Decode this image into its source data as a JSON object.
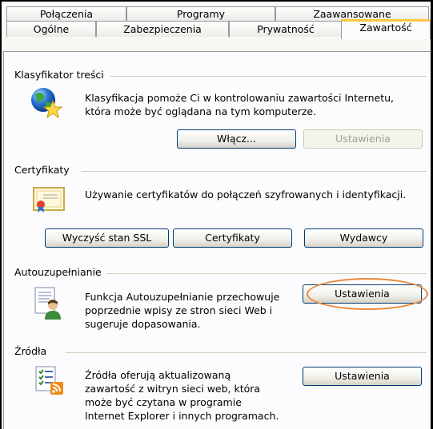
{
  "tabs_row1": [
    "Połączenia",
    "Programy",
    "Zaawansowane"
  ],
  "tabs_row2": [
    "Ogólne",
    "Zabezpieczenia",
    "Prywatność",
    "Zawartość"
  ],
  "content_advisor": {
    "title": "Klasyfikator treści",
    "desc_line1": "Klasyfikacja pomoże Ci w kontrolowaniu zawartości Internetu,",
    "desc_line2": "która może być oglądana na tym komputerze.",
    "enable_button": "Włącz...",
    "settings_button": "Ustawienia"
  },
  "certificates": {
    "title": "Certyfikaty",
    "desc": "Używanie certyfikatów do połączeń szyfrowanych i identyfikacji.",
    "clear_ssl_button": "Wyczyść stan SSL",
    "certificates_button": "Certyfikaty",
    "publishers_button": "Wydawcy"
  },
  "autocomplete": {
    "title": "Autouzupełnianie",
    "desc_line1": "Funkcja Autouzupełnianie przechowuje",
    "desc_line2": "poprzednie wpisy ze stron sieci Web i",
    "desc_line3": "sugeruje dopasowania.",
    "settings_button": "Ustawienia"
  },
  "feeds": {
    "title": "Źródła",
    "desc_line1": "Źródła oferują aktualizowaną",
    "desc_line2": "zawartość z witryn sieci web, która",
    "desc_line3": "może być czytana w programie",
    "desc_line4": "Internet Explorer i innych programach.",
    "settings_button": "Ustawienia"
  },
  "colors": {
    "accent_tab": "#ffc83c",
    "button_border": "#003c74",
    "highlight": "#e8883a"
  }
}
